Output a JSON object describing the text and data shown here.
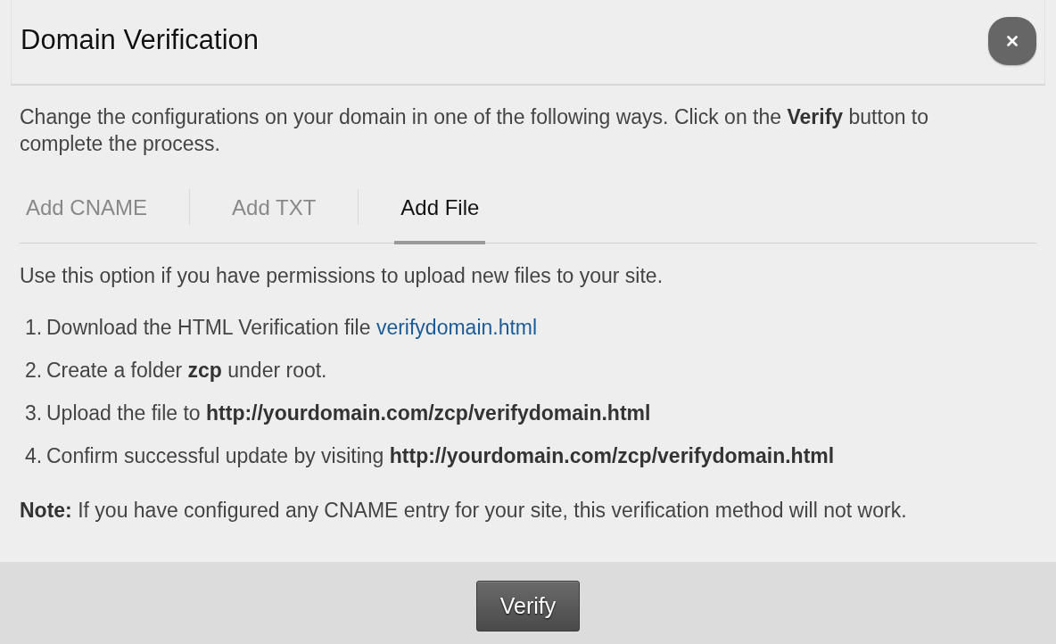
{
  "dialog": {
    "title": "Domain Verification"
  },
  "intro": "Change the configurations on your domain in one of the following ways. Click on the **Verify** button to complete the process.",
  "tabs": [
    {
      "label": "Add CNAME",
      "selected": false
    },
    {
      "label": "Add TXT",
      "selected": false
    },
    {
      "label": "Add File",
      "selected": true
    }
  ],
  "panel": {
    "description": "Use this option if you have permissions to upload new files to your site.",
    "steps": [
      {
        "number": "1.",
        "text": "Download the HTML Verification file",
        "link": "verifydomain.html"
      },
      {
        "number": "2.",
        "text": "Create a folder **zcp** under root."
      },
      {
        "number": "3.",
        "text": "Upload the file to **http://yourdomain.com/zcp/verifydomain.html**"
      },
      {
        "number": "4.",
        "text": "Confirm successful update by visiting **http://yourdomain.com/zcp/verifydomain.html**"
      }
    ],
    "note": "**Note:** If you have configured any CNAME entry for your site, this verification method will not work."
  },
  "footer": {
    "buttons": [
      {
        "label": "Verify"
      }
    ]
  }
}
